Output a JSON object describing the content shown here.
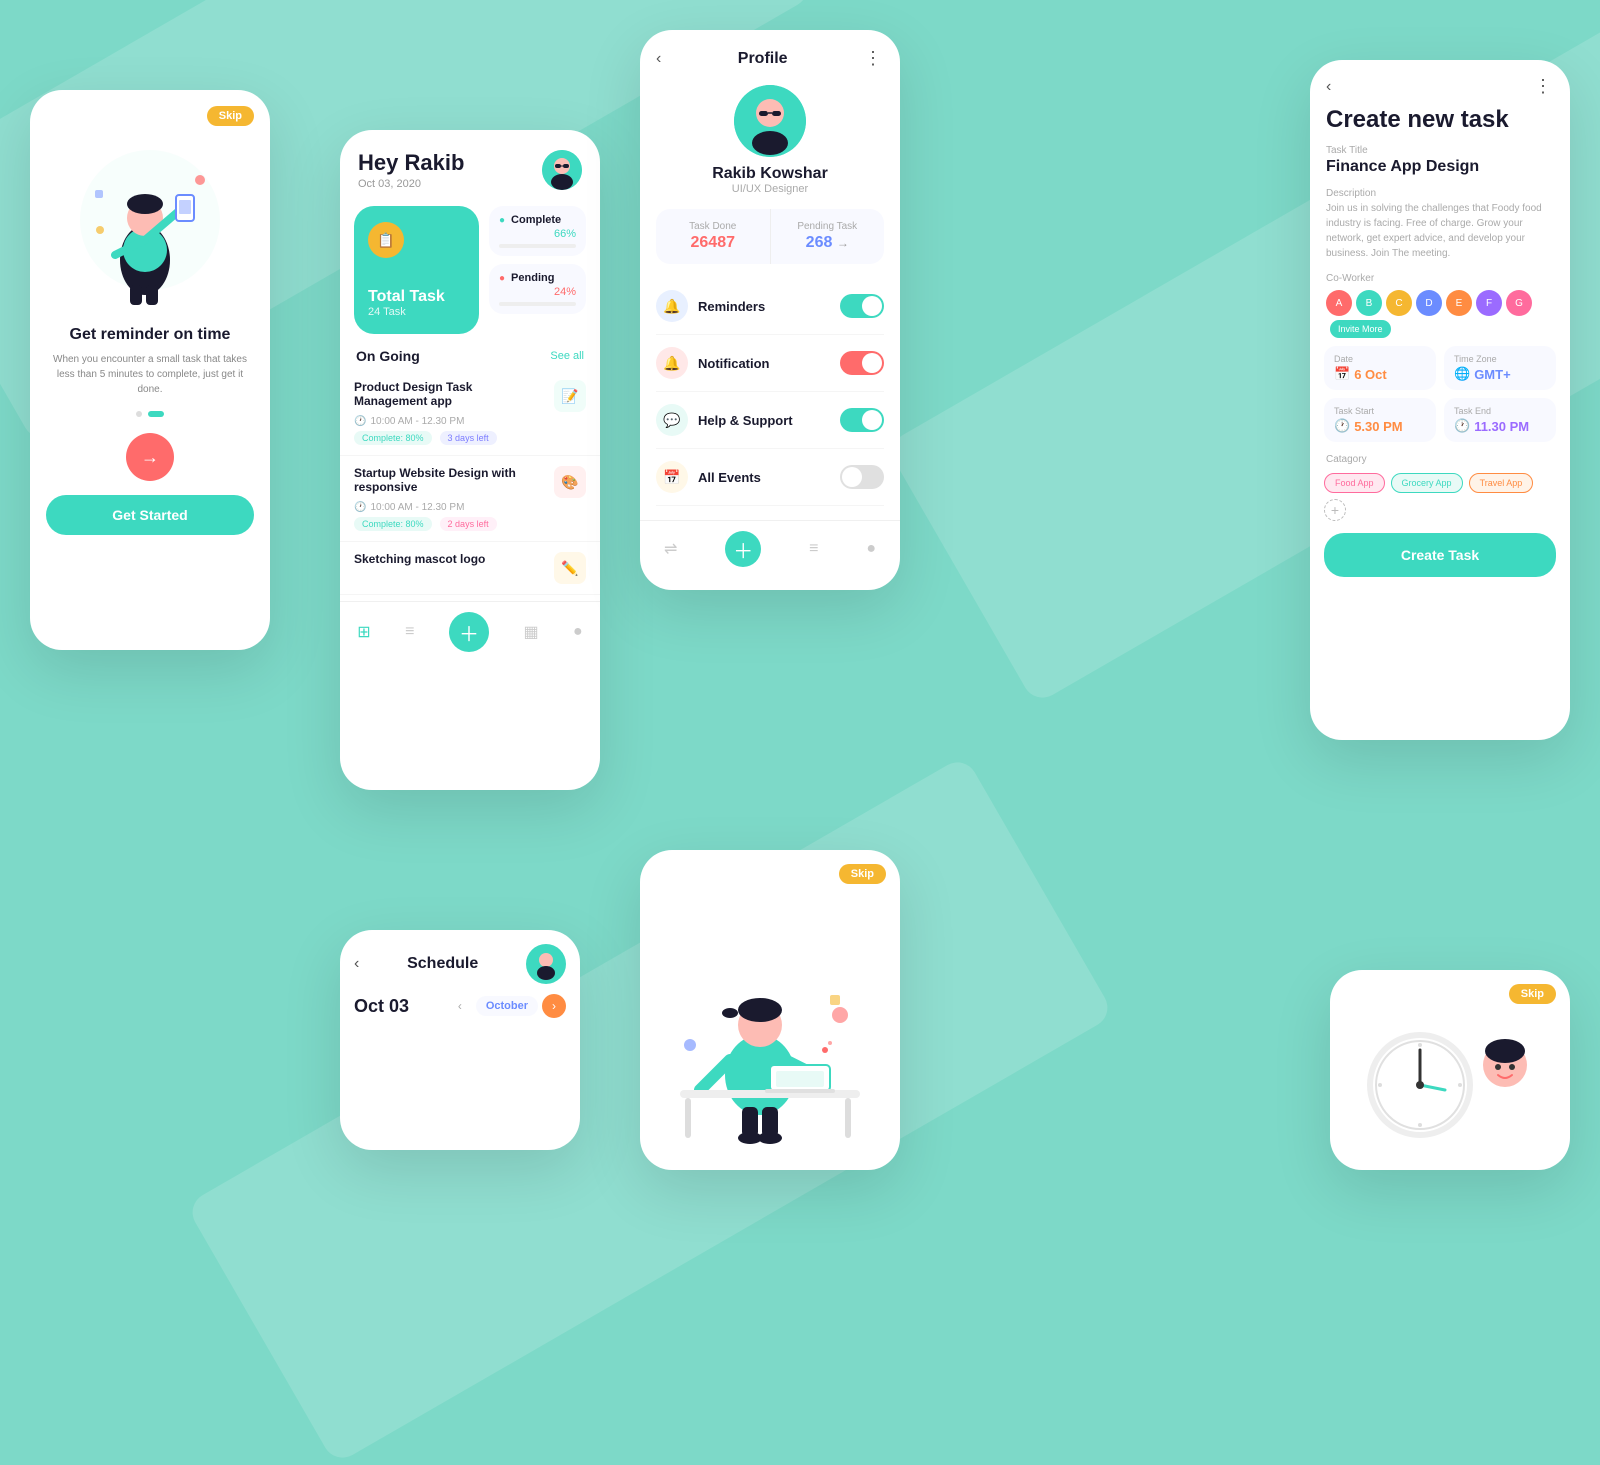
{
  "background": "#7DD9C8",
  "screen_reminder": {
    "skip_label": "Skip",
    "title": "Get reminder on time",
    "subtitle": "When you encounter a small task that takes less than 5 minutes to complete, just get it done.",
    "get_started_label": "Get Started"
  },
  "screen_dashboard": {
    "greeting": "Hey Rakib",
    "date": "Oct 03, 2020",
    "total_task_label": "Total Task",
    "total_task_count": "24 Task",
    "complete_label": "Complete",
    "complete_percent": "66%",
    "pending_label": "Pending",
    "pending_percent": "24%",
    "on_going_label": "On Going",
    "see_all_label": "See all",
    "tasks": [
      {
        "title": "Product Design Task Management app",
        "time": "10:00 AM - 12.30 PM",
        "complete": "Complete: 80%",
        "days_left": "3 days left"
      },
      {
        "title": "Startup Website Design with responsive",
        "time": "10:00 AM - 12.30 PM",
        "complete": "Complete: 80%",
        "days_left": "2 days left"
      },
      {
        "title": "Sketching mascot logo",
        "time": "",
        "complete": "",
        "days_left": ""
      }
    ]
  },
  "screen_profile": {
    "title": "Profile",
    "name": "Rakib Kowshar",
    "role": "UI/UX Designer",
    "task_done_label": "Task Done",
    "task_done_value": "26487",
    "pending_task_label": "Pending Task",
    "pending_task_value": "268",
    "menu_items": [
      {
        "icon": "🔔",
        "label": "Reminders",
        "toggle": "on"
      },
      {
        "icon": "🔔",
        "label": "Notification",
        "toggle": "red"
      },
      {
        "icon": "💬",
        "label": "Help & Support",
        "toggle": "on"
      },
      {
        "icon": "📅",
        "label": "All Events",
        "toggle": "off"
      }
    ]
  },
  "screen_create_task": {
    "title": "Create new task",
    "task_title_label": "Task Title",
    "task_title_value": "Finance App Design",
    "description_label": "Description",
    "description_value": "Join us in solving the challenges that Foody food industry is facing. Free of charge. Grow your network, get expert advice, and develop your business. Join The meeting.",
    "coworker_label": "Co-Worker",
    "invite_more_label": "Invite More",
    "date_label": "Date",
    "date_value": "6 Oct",
    "timezone_label": "Time Zone",
    "timezone_value": "GMT+",
    "task_start_label": "Task Start",
    "task_start_value": "5.30 PM",
    "task_end_label": "Task End",
    "task_end_value": "11.30 PM",
    "category_label": "Catagory",
    "categories": [
      "Food App",
      "Grocery App",
      "Travel App"
    ],
    "create_btn_label": "Create Task"
  },
  "screen_schedule": {
    "title": "Schedule",
    "date": "Oct 03",
    "month_label": "October"
  },
  "screen_bottom_right": {
    "skip_label": "Skip"
  },
  "screen_illus2": {
    "skip_label": "Skip"
  }
}
